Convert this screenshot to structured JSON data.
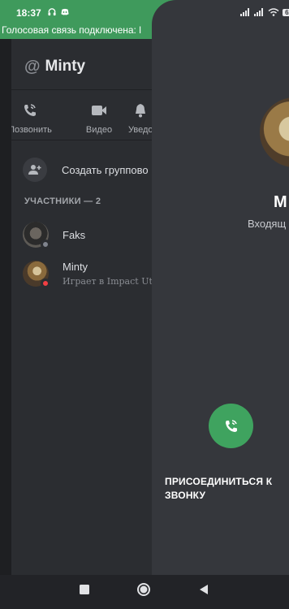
{
  "status_bar": {
    "time": "18:37",
    "icons": [
      "headphones-icon",
      "discord-icon",
      "signal-icon",
      "signal-icon",
      "wifi-icon",
      "battery-icon"
    ],
    "battery": "62"
  },
  "voice_banner": "Голосовая связь подключена: l",
  "channel": {
    "title": "Minty",
    "prefix": "@"
  },
  "actions": [
    {
      "label": "Позвонить",
      "icon": "phone-call-icon"
    },
    {
      "label": "Видео",
      "icon": "video-camera-icon"
    },
    {
      "label": "Уведо",
      "icon": "bell-icon"
    }
  ],
  "create_group": {
    "label": "Создать группово",
    "icon": "add-user-icon"
  },
  "members_header": "УЧАСТНИКИ — 2",
  "members": [
    {
      "name": "Faks",
      "status": "offline",
      "activity": ""
    },
    {
      "name": "Minty",
      "status": "dnd",
      "activity": "Играет в Impact Utilit"
    }
  ],
  "call": {
    "name": "M",
    "status": "Входящ",
    "join_label": "ПРИСОЕДИНИТЬСЯ К ЗВОНКУ"
  },
  "colors": {
    "accent_green": "#3fa35f",
    "panel_bg": "#2b2d31",
    "overlay_bg": "#35373c"
  },
  "nav": [
    "recents-button",
    "home-button",
    "back-button"
  ]
}
